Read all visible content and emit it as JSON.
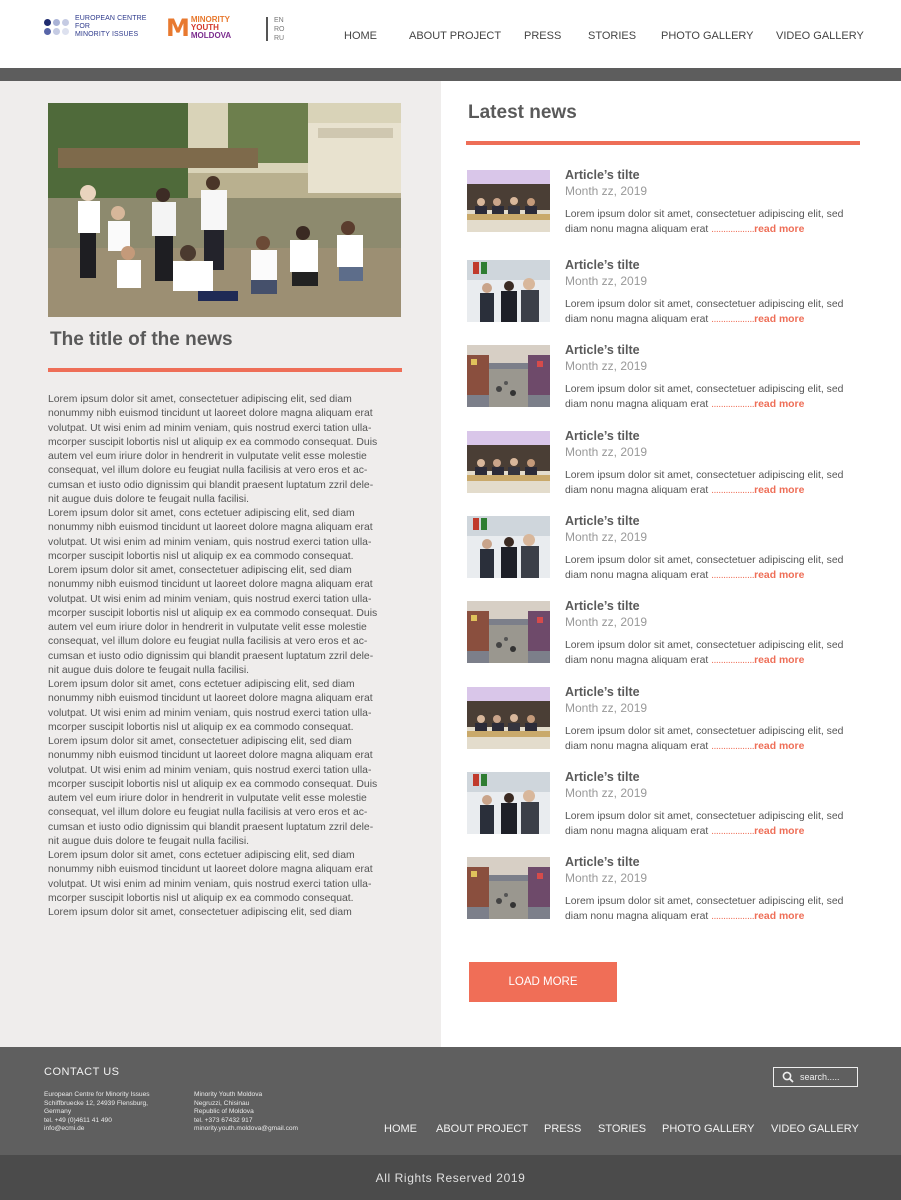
{
  "header": {
    "ecmi_logo_text": [
      "EUROPEAN CENTRE",
      "FOR",
      "MINORITY ISSUES"
    ],
    "my_logo_text": [
      "MINORITY",
      "YOUTH",
      "MOLDOVA"
    ],
    "languages": [
      "EN",
      "RO",
      "RU"
    ],
    "nav": [
      {
        "label": "HOME"
      },
      {
        "label": "ABOUT PROJECT"
      },
      {
        "label": "PRESS"
      },
      {
        "label": "STORIES"
      },
      {
        "label": "PHOTO GALLERY"
      },
      {
        "label": "VIDEO GALLERY"
      }
    ]
  },
  "main_news": {
    "title": "The title of the news",
    "body": "Lorem ipsum dolor sit amet, consectetuer adipiscing elit, sed diam\nnonummy nibh euismod tincidunt ut laoreet dolore magna aliquam erat\nvolutpat. Ut wisi enim ad minim veniam, quis nostrud exerci tation ulla-\nmcorper suscipit lobortis nisl ut aliquip ex ea commodo consequat. Duis\nautem vel eum iriure dolor in hendrerit in vulputate velit esse molestie\nconsequat, vel illum dolore eu feugiat nulla facilisis at vero eros et ac-\ncumsan et iusto odio dignissim qui blandit praesent luptatum zzril dele-\nnit augue duis dolore te feugait nulla facilisi.\nLorem ipsum dolor sit amet, cons ectetuer adipiscing elit, sed diam\nnonummy nibh euismod tincidunt ut laoreet dolore magna aliquam erat\nvolutpat. Ut wisi enim ad minim veniam, quis nostrud exerci tation ulla-\nmcorper suscipit lobortis nisl ut aliquip ex ea commodo consequat.\nLorem ipsum dolor sit amet, consectetuer adipiscing elit, sed diam\nnonummy nibh euismod tincidunt ut laoreet dolore magna aliquam erat\nvolutpat. Ut wisi enim ad minim veniam, quis nostrud exerci tation ulla-\nmcorper suscipit lobortis nisl ut aliquip ex ea commodo consequat. Duis\nautem vel eum iriure dolor in hendrerit in vulputate velit esse molestie\nconsequat, vel illum dolore eu feugiat nulla facilisis at vero eros et ac-\ncumsan et iusto odio dignissim qui blandit praesent luptatum zzril dele-\nnit augue duis dolore te feugait nulla facilisi.\nLorem ipsum dolor sit amet, cons ectetuer adipiscing elit, sed diam\nnonummy nibh euismod tincidunt ut laoreet dolore magna aliquam erat\nvolutpat. Ut wisi enim ad minim veniam, quis nostrud exerci tation ulla-\nmcorper suscipit lobortis nisl ut aliquip ex ea commodo consequat.\nLorem ipsum dolor sit amet, consectetuer adipiscing elit, sed diam\nnonummy nibh euismod tincidunt ut laoreet dolore magna aliquam erat\nvolutpat. Ut wisi enim ad minim veniam, quis nostrud exerci tation ulla-\nmcorper suscipit lobortis nisl ut aliquip ex ea commodo consequat. Duis\nautem vel eum iriure dolor in hendrerit in vulputate velit esse molestie\nconsequat, vel illum dolore eu feugiat nulla facilisis at vero eros et ac-\ncumsan et iusto odio dignissim qui blandit praesent luptatum zzril dele-\nnit augue duis dolore te feugait nulla facilisi.\nLorem ipsum dolor sit amet, cons ectetuer adipiscing elit, sed diam\nnonummy nibh euismod tincidunt ut laoreet dolore magna aliquam erat\nvolutpat. Ut wisi enim ad minim veniam, quis nostrud exerci tation ulla-\nmcorper suscipit lobortis nisl ut aliquip ex ea commodo consequat.\nLorem ipsum dolor sit amet, consectetuer adipiscing elit, sed diam"
  },
  "latest": {
    "title": "Latest news",
    "articles": [
      {
        "title": "Article’s tilte",
        "date": "Month zz, 2019",
        "text": "Lorem ipsum dolor sit amet, consectetuer adipiscing elit, sed diam nonu magna aliquam erat ",
        "dots": "..................",
        "more": "read more",
        "thumb": "conference"
      },
      {
        "title": "Article’s tilte",
        "date": "Month zz, 2019",
        "text": "Lorem ipsum dolor sit amet, consectetuer adipiscing elit, sed diam nonu magna aliquam erat ",
        "dots": "..................",
        "more": "read more",
        "thumb": "people"
      },
      {
        "title": "Article’s tilte",
        "date": "Month zz, 2019",
        "text": "Lorem ipsum dolor sit amet, consectetuer adipiscing elit, sed diam nonu magna aliquam erat ",
        "dots": "..................",
        "more": "read more",
        "thumb": "street"
      },
      {
        "title": "Article’s tilte",
        "date": "Month zz, 2019",
        "text": "Lorem ipsum dolor sit amet, consectetuer adipiscing elit, sed diam nonu magna aliquam erat ",
        "dots": "..................",
        "more": "read more",
        "thumb": "conference"
      },
      {
        "title": "Article’s tilte",
        "date": "Month zz, 2019",
        "text": "Lorem ipsum dolor sit amet, consectetuer adipiscing elit, sed diam nonu magna aliquam erat ",
        "dots": "..................",
        "more": "read more",
        "thumb": "people"
      },
      {
        "title": "Article’s tilte",
        "date": "Month zz, 2019",
        "text": "Lorem ipsum dolor sit amet, consectetuer adipiscing elit, sed diam nonu magna aliquam erat ",
        "dots": "..................",
        "more": "read more",
        "thumb": "street"
      },
      {
        "title": "Article’s tilte",
        "date": "Month zz, 2019",
        "text": "Lorem ipsum dolor sit amet, consectetuer adipiscing elit, sed diam nonu magna aliquam erat ",
        "dots": "..................",
        "more": "read more",
        "thumb": "conference"
      },
      {
        "title": "Article’s tilte",
        "date": "Month zz, 2019",
        "text": "Lorem ipsum dolor sit amet, consectetuer adipiscing elit, sed diam nonu magna aliquam erat ",
        "dots": "..................",
        "more": "read more",
        "thumb": "people"
      },
      {
        "title": "Article’s tilte",
        "date": "Month zz, 2019",
        "text": "Lorem ipsum dolor sit amet, consectetuer adipiscing elit, sed diam nonu magna aliquam erat ",
        "dots": "..................",
        "more": "read more",
        "thumb": "street"
      }
    ],
    "load_more": "LOAD MORE"
  },
  "footer": {
    "contact_title": "CONTACT  US",
    "ecmi_address": [
      "European Centre for Minority Issues",
      "Schiffbruecke 12, 24939 Flensburg,",
      "Germany",
      "tel. +49 (0)4611 41 490",
      "info@ecmi.de"
    ],
    "my_address": [
      "Minority Youth Moldova",
      "Negruzzi, Chisinau",
      "Republic of Moldova",
      "tel. +373 67432 917",
      "minority.youth.moldova@gmail.com"
    ],
    "search_placeholder": "search.....",
    "nav": [
      {
        "label": "HOME"
      },
      {
        "label": "ABOUT PROJECT"
      },
      {
        "label": "PRESS"
      },
      {
        "label": "STORIES"
      },
      {
        "label": "PHOTO GALLERY"
      },
      {
        "label": "VIDEO GALLERY"
      }
    ],
    "copyright": "All Rights Reserved 2019"
  },
  "colors": {
    "accent": "#ee6e57",
    "dark_band": "#5d5d5d",
    "footer": "#5f5f5f",
    "copyright_band": "#4b4b4b",
    "left_bg": "#efedec"
  },
  "icons": {
    "search": "search-icon"
  }
}
